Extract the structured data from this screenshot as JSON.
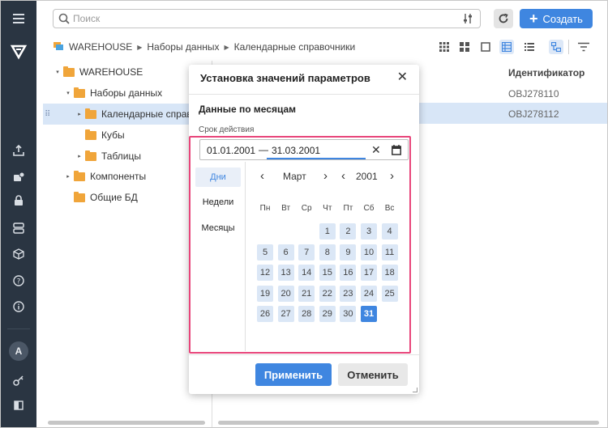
{
  "toolbar": {
    "search_placeholder": "Поиск",
    "create_label": "Создать",
    "create_plus": "+"
  },
  "breadcrumb": [
    "WAREHOUSE",
    "Наборы данных",
    "Календарные справочники"
  ],
  "tree": [
    {
      "label": "WAREHOUSE",
      "toggle": "▾"
    },
    {
      "label": "Наборы данных",
      "toggle": "▾"
    },
    {
      "label": "Календарные справо",
      "toggle": "▸",
      "selected": true,
      "grip": "⠿"
    },
    {
      "label": "Кубы",
      "toggle": ""
    },
    {
      "label": "Таблицы",
      "toggle": "▸"
    },
    {
      "label": "Компоненты",
      "toggle": "▸"
    },
    {
      "label": "Общие БД",
      "toggle": ""
    }
  ],
  "list": {
    "column_header": "Идентификатор",
    "rows": [
      "OBJ278110",
      "OBJ278112"
    ]
  },
  "rail": {
    "avatar_letter": "A"
  },
  "dialog": {
    "title": "Установка значений параметров",
    "close": "✕",
    "section": "Данные по месяцам",
    "field_label": "Срок действия",
    "date_from": "01.01.2001",
    "dash": "—",
    "date_to": "31.03.2001",
    "clear": "✕",
    "modes": [
      "Дни",
      "Недели",
      "Месяцы"
    ],
    "active_mode": "Дни",
    "month": "Март",
    "year": "2001",
    "nav_prev": "‹",
    "nav_next": "›",
    "weekdays": [
      "Пн",
      "Вт",
      "Ср",
      "Чт",
      "Пт",
      "Сб",
      "Вс"
    ],
    "days": [
      "1",
      "2",
      "3",
      "4",
      "5",
      "6",
      "7",
      "8",
      "9",
      "10",
      "11",
      "12",
      "13",
      "14",
      "15",
      "16",
      "17",
      "18",
      "19",
      "20",
      "21",
      "22",
      "23",
      "24",
      "25",
      "26",
      "27",
      "28",
      "29",
      "30",
      "31"
    ],
    "selected_day": "31",
    "apply_label": "Применить",
    "cancel_label": "Отменить"
  },
  "colors": {
    "accent": "#3f86e0",
    "rail": "#2a3542",
    "highlight_border": "#e8457a",
    "day_bg": "#dbe7f6",
    "folder": "#f0a53a"
  }
}
